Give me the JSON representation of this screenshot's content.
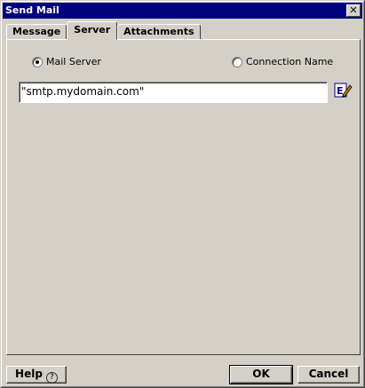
{
  "window": {
    "title": "Send Mail",
    "close_glyph": "✕"
  },
  "tabs": [
    {
      "label": "Message",
      "active": false
    },
    {
      "label": "Server",
      "active": true
    },
    {
      "label": "Attachments",
      "active": false
    }
  ],
  "server": {
    "options": [
      {
        "label": "Mail Server",
        "checked": true
      },
      {
        "label": "Connection Name",
        "checked": false
      }
    ],
    "value": "\"smtp.mydomain.com\"",
    "edit_icon": "edit-expression-icon"
  },
  "buttons": {
    "help": "Help",
    "help_glyph": "?",
    "ok": "OK",
    "cancel": "Cancel"
  }
}
